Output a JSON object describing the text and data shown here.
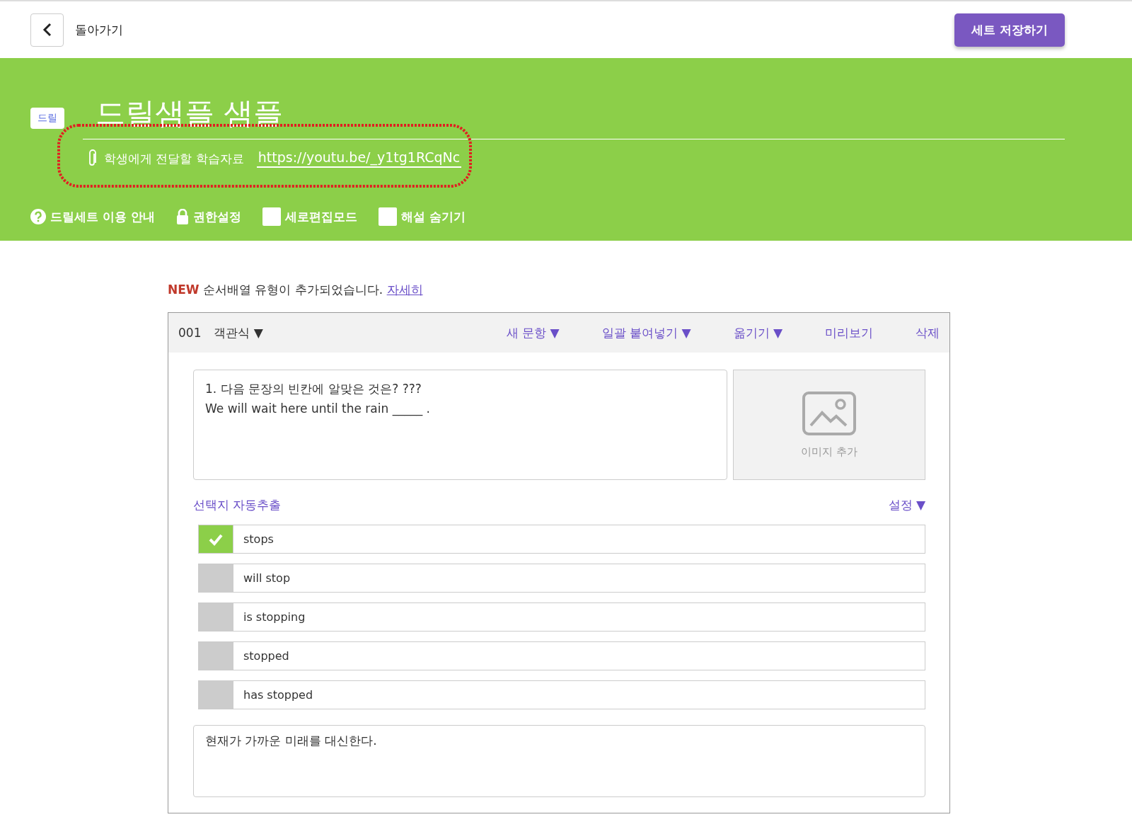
{
  "top_bar": {
    "back_label": "돌아가기",
    "save_button": "세트 저장하기"
  },
  "header": {
    "tag": "드릴",
    "title": "드릴샘플 샘플",
    "material_label": "학생에게 전달할 학습자료",
    "material_link": "https://youtu.be/_y1tg1RCqNc",
    "options": [
      {
        "kind": "help",
        "label": "드릴세트 이용 안내"
      },
      {
        "kind": "lock",
        "label": "권한설정"
      },
      {
        "kind": "checkbox",
        "label": "세로편집모드",
        "checked": false
      },
      {
        "kind": "checkbox",
        "label": "해설 숨기기",
        "checked": false
      }
    ]
  },
  "notice": {
    "badge": "NEW",
    "text": "순서배열 유형이 추가되었습니다.",
    "link": "자세히"
  },
  "question": {
    "number": "001",
    "type": "객관식",
    "type_arrow": "▼",
    "actions": [
      {
        "label": "새 문항",
        "arrow": "▼"
      },
      {
        "label": "일괄 붙여넣기",
        "arrow": "▼"
      },
      {
        "label": "옮기기",
        "arrow": "▼"
      },
      {
        "label": "미리보기"
      },
      {
        "label": "삭제"
      }
    ],
    "prompt_lines": [
      "1. 다음 문장의 빈칸에 알맞은 것은? ???",
      "We will wait here until the rain _____ ."
    ],
    "image_label": "이미지 추가",
    "auto_extract": "선택지 자동추출",
    "settings": "설정",
    "settings_arrow": "▼",
    "choices": [
      {
        "text": "stops",
        "correct": true
      },
      {
        "text": "will stop",
        "correct": false
      },
      {
        "text": "is stopping",
        "correct": false
      },
      {
        "text": "stopped",
        "correct": false
      },
      {
        "text": "has stopped",
        "correct": false
      }
    ],
    "explanation": "현재가 가까운 미래를 대신한다."
  }
}
